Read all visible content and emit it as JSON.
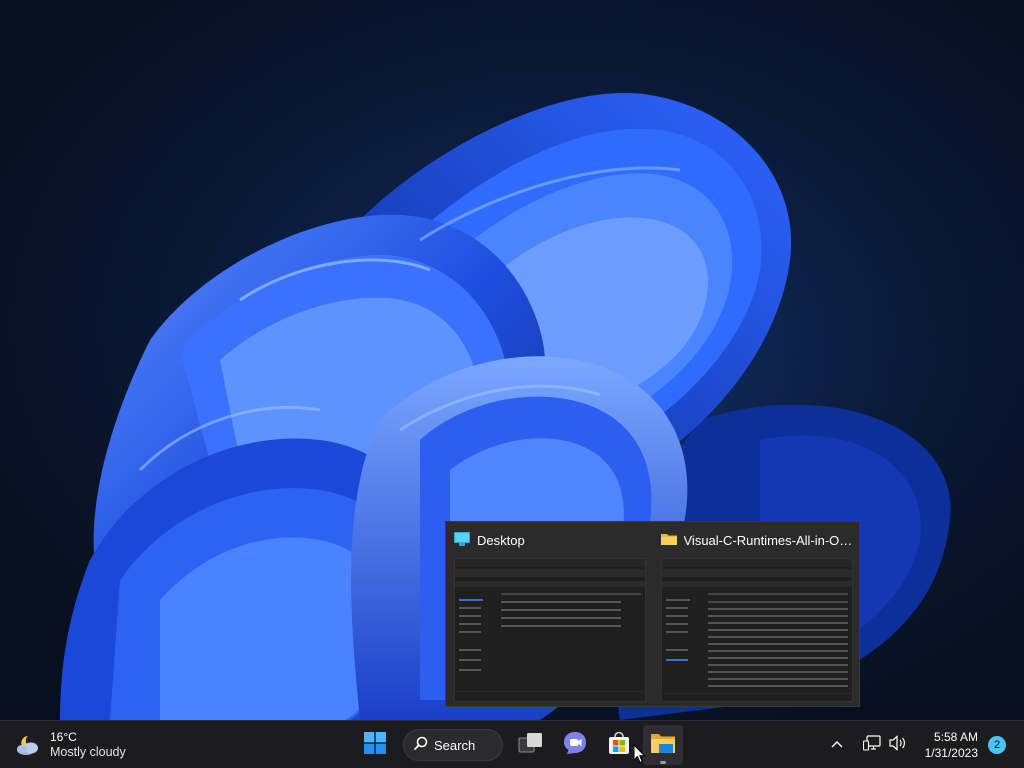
{
  "desktop": {
    "wallpaper": "windows-11-bloom-blue"
  },
  "taskbar": {
    "weather": {
      "temperature": "16°C",
      "condition": "Mostly cloudy",
      "icon": "cloud-moon-icon"
    },
    "pinned": [
      {
        "name": "start",
        "icon": "windows-logo-icon"
      },
      {
        "name": "search",
        "icon": "search-icon",
        "label": "Search"
      },
      {
        "name": "task-view",
        "icon": "task-view-icon"
      },
      {
        "name": "teams-chat",
        "icon": "teams-chat-icon"
      },
      {
        "name": "microsoft-store",
        "icon": "store-icon"
      },
      {
        "name": "file-explorer",
        "icon": "folder-icon",
        "running": true,
        "active": true
      }
    ],
    "tray": {
      "clock_time": "5:58 AM",
      "clock_date": "1/31/2023",
      "notification_count": "2"
    }
  },
  "flyout": {
    "windows": [
      {
        "title": "Desktop",
        "icon": "desktop-icon"
      },
      {
        "title": "Visual-C-Runtimes-All-in-On...",
        "icon": "folder-icon"
      }
    ]
  },
  "colors": {
    "taskbar": "#1c1c1e",
    "accent": "#4cc2ff",
    "bloom": "#1f4fe0"
  }
}
